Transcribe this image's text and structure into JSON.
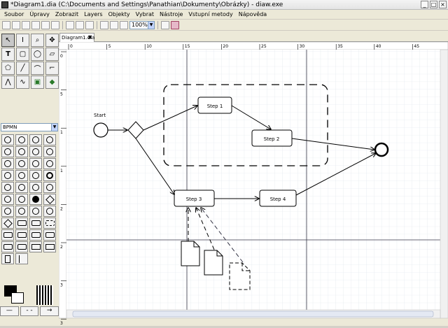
{
  "window": {
    "title": "*Diagram1.dia (C:\\Documents and Settings\\Panathian\\Dokumenty\\Obrázky) - diaw.exe"
  },
  "menu": [
    "Soubor",
    "Úpravy",
    "Zobrazit",
    "Layers",
    "Objekty",
    "Vybrat",
    "Nástroje",
    "Vstupní metody",
    "Nápověda"
  ],
  "toolbar": {
    "zoom_value": "100%"
  },
  "sheet_selector": "BPMN",
  "tabs": [
    {
      "label": "Diagram1.dia"
    }
  ],
  "ruler": {
    "h_ticks": [
      "0",
      "5",
      "10",
      "15",
      "20",
      "25",
      "30",
      "35",
      "40",
      "45"
    ],
    "v_ticks": [
      "0",
      "5",
      "1",
      "1",
      "2",
      "2",
      "3",
      "3"
    ]
  },
  "diagram": {
    "start_label": "Start",
    "tasks": [
      "Step 1",
      "Step 2",
      "Step 3",
      "Step 4"
    ]
  }
}
